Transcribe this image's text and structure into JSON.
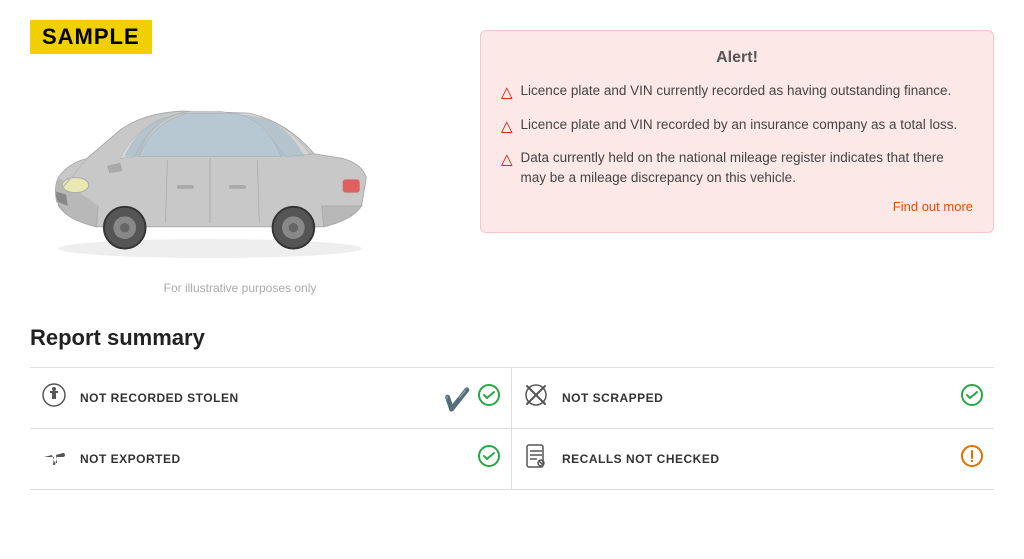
{
  "sample_badge": "SAMPLE",
  "illustrative_note": "For illustrative purposes only",
  "alert": {
    "title": "Alert!",
    "items": [
      "Licence plate and VIN currently recorded as having outstanding finance.",
      "Licence plate and VIN recorded by an insurance company as a total loss.",
      "Data currently held on the national mileage register indicates that there may be a mileage discrepancy on this vehicle."
    ],
    "find_out_more": "Find out more"
  },
  "report_summary": {
    "title": "Report summary",
    "rows": [
      {
        "label": "NOT RECORDED STOLEN",
        "icon": "police",
        "status": "green"
      },
      {
        "label": "NOT SCRAPPED",
        "icon": "scrapped",
        "status": "green"
      },
      {
        "label": "NOT EXPORTED",
        "icon": "exported",
        "status": "green"
      },
      {
        "label": "RECALLS NOT CHECKED",
        "icon": "recalls",
        "status": "orange"
      }
    ]
  }
}
